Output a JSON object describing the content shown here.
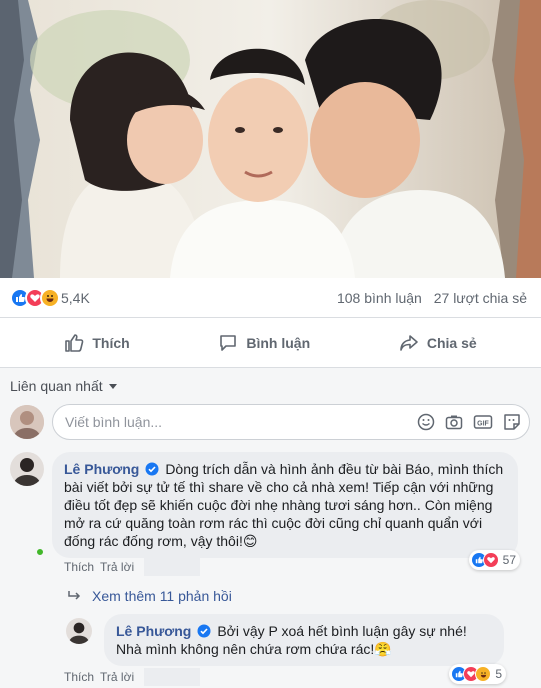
{
  "post": {
    "image_alt": "Ảnh gia đình: mẹ và bố hôn má con trai"
  },
  "stats": {
    "reaction_count": "5,4K",
    "comments_count": "108 bình luận",
    "shares_count": "27 lượt chia sẻ",
    "reaction_icons": [
      "like-icon",
      "love-icon",
      "haha-icon"
    ]
  },
  "actions": {
    "like_label": "Thích",
    "comment_label": "Bình luận",
    "share_label": "Chia sẻ"
  },
  "comments_section": {
    "sort_label": "Liên quan nhất",
    "composer_placeholder": "Viết bình luận...",
    "composer_tools": [
      "emoji-icon",
      "camera-icon",
      "gif-icon",
      "sticker-icon"
    ]
  },
  "comment_main": {
    "author": "Lê Phương",
    "text": "Dòng trích dẫn và hình ảnh đều từ bài Báo, mình thích bài viết bởi sự tử tế thì share về cho cả nhà xem! Tiếp cận với những điều tốt đẹp sẽ khiến cuộc đời nhẹ nhàng tươi sáng hơn.. Còn miệng mở ra cứ quăng toàn rơm rác thì cuộc đời cũng chỉ quanh quẩn với đống rác đống rơm, vậy thôi!😊",
    "reaction_count": "57",
    "like_link": "Thích",
    "reply_link": "Trả lời"
  },
  "more_replies": {
    "label": "Xem thêm 11 phản hồi"
  },
  "comment_reply": {
    "author": "Lê Phương",
    "text": "Bởi vậy P xoá hết bình luận gây sự nhé! Nhà mình không nên chứa rơm chứa rác!😤",
    "reaction_count": "5",
    "like_link": "Thích",
    "reply_link": "Trả lời"
  },
  "colors": {
    "link_blue": "#385898",
    "like_blue": "#1877f2",
    "love_red": "#f33e58",
    "haha_yellow": "#f7b125",
    "muted_text": "#606770",
    "bubble_bg": "#ebedf0"
  }
}
